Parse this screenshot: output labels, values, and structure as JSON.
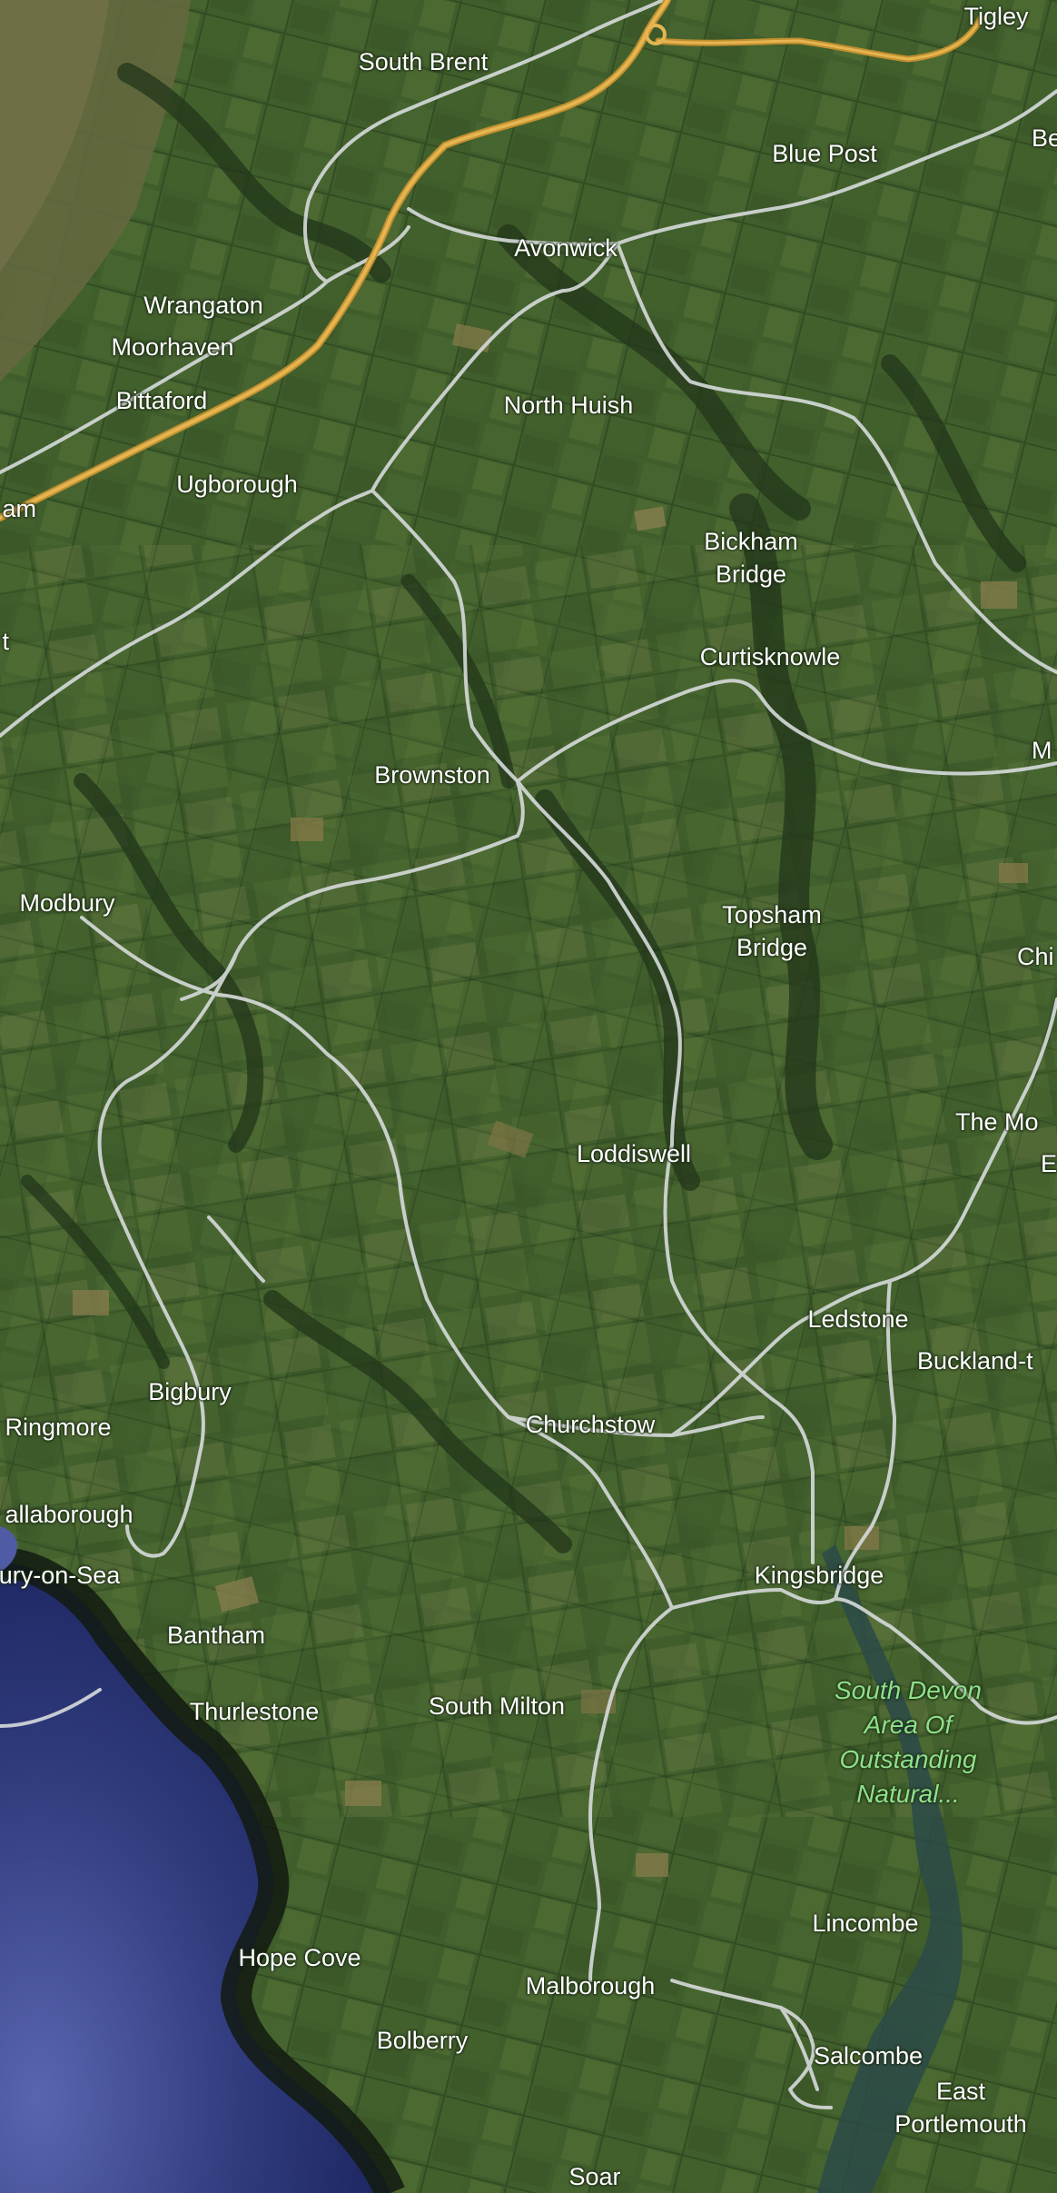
{
  "map": {
    "type": "satellite",
    "colors": {
      "land": "#3f5c2b",
      "field_dark": "#2c4420",
      "field_light": "#5f7a3c",
      "field_tan": "#8a7a4e",
      "moor": "#6e6a48",
      "sea": "#25306a",
      "sea_light": "#5561a8",
      "coast": "#141c12",
      "road_minor": "#d8dcdc",
      "road_major": "#e3b24a"
    },
    "places": {
      "tigley": "Tigley",
      "south_brent": "South Brent",
      "blue_post": "Blue Post",
      "be": "Be",
      "avonwick": "Avonwick",
      "wrangaton": "Wrangaton",
      "moorhaven": "Moorhaven",
      "bittaford": "Bittaford",
      "north_huish": "North Huish",
      "am": "am",
      "ugborough": "Ugborough",
      "bickham_bridge_1": "Bickham",
      "bickham_bridge_2": "Bridge",
      "t": "t",
      "curtisknowle": "Curtisknowle",
      "m": "M",
      "brownston": "Brownston",
      "modbury": "Modbury",
      "topsham_bridge_1": "Topsham",
      "topsham_bridge_2": "Bridge",
      "chi": "Chi",
      "the_mo": "The Mo",
      "e": "E",
      "loddiswell": "Loddiswell",
      "ledstone": "Ledstone",
      "buckland": "Buckland-t",
      "bigbury": "Bigbury",
      "ringmore": "Ringmore",
      "churchstow": "Churchstow",
      "challaborough": "allaborough",
      "bigbury_on_sea": "oury-on-Sea",
      "kingsbridge": "Kingsbridge",
      "bantham": "Bantham",
      "aonb_1": "South Devon",
      "aonb_2": "Area Of",
      "aonb_3": "Outstanding",
      "aonb_4": "Natural...",
      "thurlestone": "Thurlestone",
      "south_milton": "South Milton",
      "lincombe": "Lincombe",
      "hope_cove": "Hope Cove",
      "malborough": "Malborough",
      "bolberry": "Bolberry",
      "salcombe": "Salcombe",
      "east_portlemouth_1": "East",
      "east_portlemouth_2": "Portlemouth",
      "soar": "Soar"
    }
  }
}
